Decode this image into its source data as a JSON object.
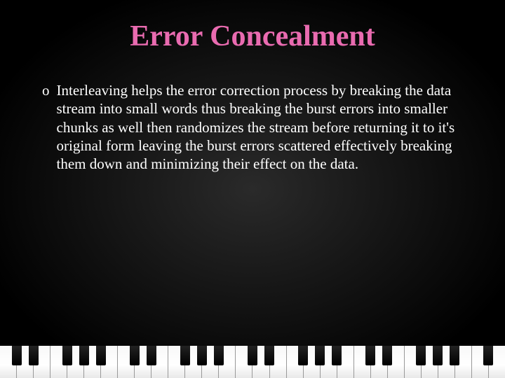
{
  "title": "Error Concealment",
  "bullet_marker": "o",
  "body_text": "Interleaving helps the error correction process by breaking the data stream into small words thus breaking the burst errors into smaller chunks as well then randomizes the stream before returning it to it's original form leaving the burst errors scattered effectively breaking them down and minimizing their effect on the data."
}
